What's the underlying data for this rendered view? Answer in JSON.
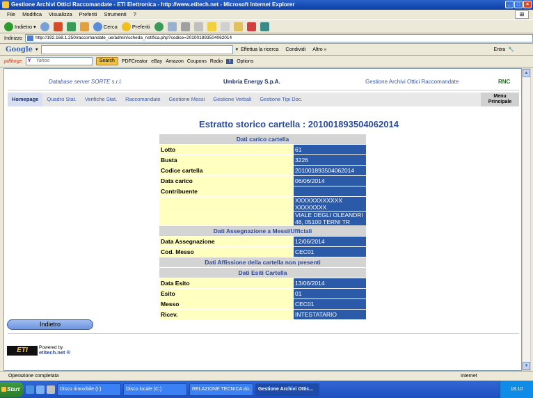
{
  "window": {
    "title": "Gestione Archivi Ottici Raccomandate - ETI Elettronica - http://www.etitech.net - Microsoft Internet Explorer",
    "menu": [
      "File",
      "Modifica",
      "Visualizza",
      "Preferiti",
      "Strumenti",
      "?"
    ]
  },
  "toolbar": {
    "back": "Indietro",
    "search": "Cerca",
    "favorites": "Preferiti"
  },
  "address": {
    "label": "Indirizzo",
    "url": "http://192.168.1.250/raccomandate_ue/admin/scheda_notifica.php?codice=201001893504062014"
  },
  "googlebar": {
    "logo": "Google",
    "search_web": "Effettua la ricerca",
    "share": "Condividi",
    "more": "Altro »",
    "signin": "Entra"
  },
  "yahoobar": {
    "brand": "pdfforge",
    "placeholder": "Yahoo",
    "search": "Search",
    "items": [
      "PDFCreator",
      "eBay",
      "Amazon",
      "Coupons",
      "Radio"
    ],
    "options": "Options"
  },
  "page": {
    "db_server": "Database server SORTE s.r.l.",
    "company": "Umbria Energy S.p.A.",
    "app_name": "Gestione Archivi Ottici Raccomandate",
    "code": "RNC",
    "nav": [
      "Homepage",
      "Quadro Stat.",
      "Verifiche Stat.",
      "Raccomandate",
      "Gestione Messi",
      "Gestione Verbali",
      "Gestione Tipi Doc."
    ],
    "menu_principale": [
      "Menu",
      "Principale"
    ],
    "title": "Estratto storico cartella : 201001893504062014",
    "sections": {
      "carico": "Dati carico cartella",
      "assegnazione": "Dati Assegnazione a Messi/Ufficiali",
      "affissione": "Dati Affissione della cartella non presenti",
      "esiti": "Dati Esiti Cartella"
    },
    "carico_rows": [
      {
        "label": "Lotto",
        "value": "61"
      },
      {
        "label": "Busta",
        "value": "3226"
      },
      {
        "label": "Codice cartella",
        "value": "201001893504062014"
      },
      {
        "label": "Data carico",
        "value": "06/06/2014"
      },
      {
        "label": "Contribuente",
        "value": ""
      },
      {
        "label": "",
        "value": "XXXXXXXXXXXX  XXXXXXXX"
      },
      {
        "label": "",
        "value": "VIALE DEGLI OLEANDRI 48, 05100 TERNI TR"
      }
    ],
    "assegnazione_rows": [
      {
        "label": "Data Assegnazione",
        "value": "12/06/2014"
      },
      {
        "label": "Cod. Messo",
        "value": "CEC01"
      }
    ],
    "esiti_rows": [
      {
        "label": "Data Esito",
        "value": "13/06/2014"
      },
      {
        "label": "Esito",
        "value": "01"
      },
      {
        "label": "Messo",
        "value": "CEC01"
      },
      {
        "label": "Ricev.",
        "value": "INTESTATARIO"
      }
    ],
    "back_button": "Indietro",
    "powered_by": "Powered by",
    "powered_site": "etitech.net ®",
    "logo_text": "ETI"
  },
  "statusbar": {
    "text": "Operazione completata",
    "zone": "Internet"
  },
  "taskbar": {
    "start": "Start",
    "tasks": [
      "Disco rimovibile (I:)",
      "Disco locale (C:)",
      "RELAZIONE TECNICA.do...",
      "Gestione Archivi Ottic..."
    ],
    "clock": "18.10"
  }
}
